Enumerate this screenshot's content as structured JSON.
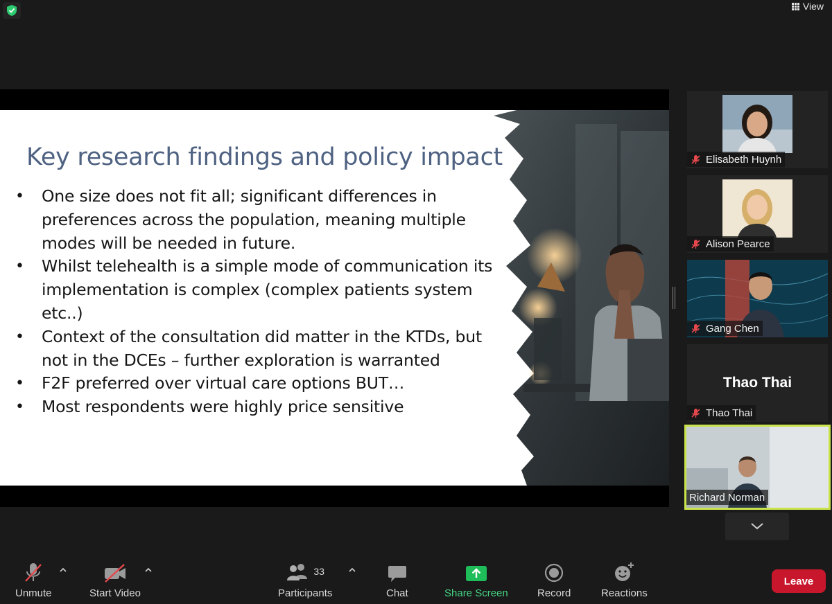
{
  "top_bar": {
    "view_label": "View"
  },
  "slide": {
    "title": "Key research findings and policy impact",
    "bullets": [
      "One size does not fit all; significant differences in preferences across the population, meaning multiple modes will be needed in future.",
      "Whilst telehealth is a simple mode of communication its implementation is complex (complex patients system etc..)",
      "Context of the consultation did matter in the KTDs, but not in the DCEs – further exploration is warranted",
      "F2F preferred over virtual care options BUT…",
      "Most respondents were highly price sensitive"
    ]
  },
  "participants_panel": [
    {
      "name": "Elisabeth Huynh",
      "muted": true,
      "video": true
    },
    {
      "name": "Alison Pearce",
      "muted": true,
      "video": true
    },
    {
      "name": "Gang Chen",
      "muted": true,
      "video": true
    },
    {
      "name": "Thao Thai",
      "muted": true,
      "video": false,
      "display_name": "Thao Thai"
    },
    {
      "name": "Richard Norman",
      "muted": false,
      "video": true,
      "active_speaker": true
    }
  ],
  "toolbar": {
    "unmute_label": "Unmute",
    "start_video_label": "Start Video",
    "participants_label": "Participants",
    "participants_count": "33",
    "chat_label": "Chat",
    "share_screen_label": "Share Screen",
    "record_label": "Record",
    "reactions_label": "Reactions",
    "leave_label": "Leave"
  },
  "colors": {
    "accent_green": "#45d483",
    "leave_red": "#c8172c",
    "active_border": "#c9e34a",
    "muted_red": "#e5484d",
    "slide_title": "#4f6282"
  }
}
